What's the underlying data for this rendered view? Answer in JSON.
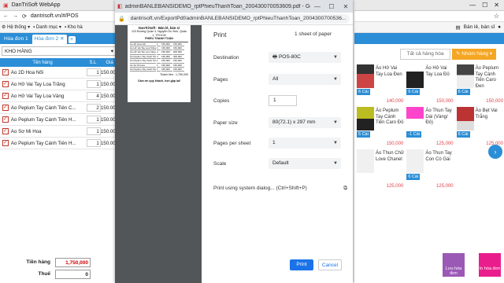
{
  "bg_app": {
    "tab_title": "DanTriSoft WebApp",
    "url": "dantrisoft.vn/#/POS",
    "menu": [
      "Hệ thống",
      "Danh mục",
      "Kho hà"
    ],
    "tabs": [
      "Hóa đơn 1",
      "Hóa đơn 2"
    ],
    "tab_plus": "+",
    "warehouse": "KHO HÀNG",
    "table_headers": {
      "name": "Tên hàng",
      "qty": "S.L",
      "price": "Giá"
    },
    "rows": [
      {
        "name": "Áo 2D Hoa Nổi",
        "qty": "1",
        "price": "150.000"
      },
      {
        "name": "Áo Hở Vai Tay Loa Trắng",
        "qty": "1",
        "price": "150.000"
      },
      {
        "name": "Áo Hở Vai Tay Loa Vàng",
        "qty": "4",
        "price": "150.000"
      },
      {
        "name": "Áo Peplum Tay Cánh Tiên C...",
        "qty": "2",
        "price": "150.000"
      },
      {
        "name": "Áo Peplum Tay Cánh Tiên H...",
        "qty": "1",
        "price": "150.000"
      },
      {
        "name": "Áo Sơ Mi Hoa",
        "qty": "1",
        "price": "150.000"
      },
      {
        "name": "Áo Peplum Tay Cánh Tiên H...",
        "qty": "1",
        "price": "150.000"
      }
    ],
    "total_label": "Tiền hàng",
    "total_value": "1,750,000",
    "tax_label": "Thuế",
    "tax_value": "0"
  },
  "bg_right": {
    "header_label": "Bán lẻ, bán sỉ",
    "category_all": "Tất cả hàng hóa",
    "group_button": "Nhóm hàng",
    "products": [
      {
        "name": "Áo Hở Vai Tay Loa Đen",
        "stock": "6 Cái",
        "price": "140,000"
      },
      {
        "name": "Áo Hở Vai Tay Loa Đỏ",
        "stock": "6 Cái",
        "price": "150,000"
      },
      {
        "name": "Áo Peplum Tay Cánh Tiên Caro Đen",
        "stock": "6 Cái",
        "price": "150,000"
      },
      {
        "name": "Áo Peplum Tay Cánh Tiên Caro Đỏ",
        "stock": "5 Cái",
        "price": "150,000"
      },
      {
        "name": "Áo Thun Tay Dài (Vàng/Đỏ)",
        "stock": "-1 Cái",
        "price": "125,000"
      },
      {
        "name": "Áo Bẹt Vai Trắng",
        "stock": "6 Cái",
        "price": "125,000"
      },
      {
        "name": "Áo Thun Chữ Love Chanel",
        "stock": "",
        "price": "125,000"
      },
      {
        "name": "Áo Thun Tay Con Cò Gái",
        "stock": "6 Cái",
        "price": "125,000"
      }
    ],
    "save_label": "Lưu hóa đơn",
    "print_label": "In hóa đơn"
  },
  "print_window": {
    "title": "adminBANLEBANSIDEMO_rptPhieuThanhToan_200430070053609.pdf - Google Chr...",
    "url": "dantrisoft.vn/ExportPdf/adminBANLEBANSIDEMO_rptPhieuThanhToan_2004300700536...",
    "heading": "Print",
    "sheets": "1 sheet of paper",
    "labels": {
      "destination": "Destination",
      "pages": "Pages",
      "copies": "Copies",
      "paper_size": "Paper size",
      "pages_per_sheet": "Pages per sheet",
      "scale": "Scale",
      "system_dialog": "Print using system dialog... (Ctrl+Shift+P)"
    },
    "values": {
      "destination": "POS-80C",
      "pages": "All",
      "copies": "1",
      "paper_size": "80(72.1) x 297 mm",
      "pages_per_sheet": "1",
      "scale": "Default"
    },
    "print_button": "Print",
    "cancel_button": "Cancel"
  },
  "receipt": {
    "shop": "DanTriSoft - Bán lẻ, bán sỉ",
    "address": "123 Đường Quận 3, Nguyễn Du Xinh, Quận 1, TP.HCM",
    "title": "PHIẾU THANH TOÁN",
    "items": [
      [
        "Áo 2D Hoa Nổi",
        "1",
        "150,000",
        "150,000"
      ],
      [
        "Áo Hở Vai Tay Loa Trắng",
        "1",
        "150,000",
        "150,000"
      ],
      [
        "Áo Hở Vai Tay Loa Vàng",
        "4",
        "150,000",
        "600,000"
      ],
      [
        "Áo Peplum Tay Cánh Tiên Caro",
        "2",
        "150,000",
        "300,000"
      ],
      [
        "Áo Peplum Tay Cánh Tiên Hồng",
        "1",
        "150,000",
        "150,000"
      ],
      [
        "Áo Sơ Mi Hoa",
        "1",
        "150,000",
        "150,000"
      ],
      [
        "Áo Peplum Tay Cánh Tiên Hồng",
        "1",
        "150,000",
        "150,000"
      ]
    ],
    "total": "Thành tiền : 1,750,000",
    "thanks": "Cảm ơn quý khách, hẹn gặp lại!"
  },
  "colors": {
    "accent": "#2b8ed6",
    "print_blue": "#1a73e8",
    "price_red": "#e0434a"
  }
}
